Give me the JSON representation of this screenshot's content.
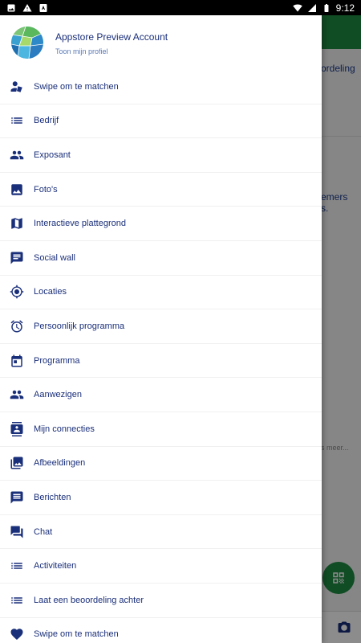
{
  "status_bar": {
    "time": "9:12"
  },
  "background": {
    "text_1": "ordeling",
    "text_2": "emers",
    "text_3": "s.",
    "text_4": "s meer..."
  },
  "profile": {
    "name": "Appstore Preview Account",
    "subtitle": "Toon mijn profiel"
  },
  "menu": [
    {
      "label": "Swipe om te matchen",
      "icon": "person-swipe-icon"
    },
    {
      "label": "Bedrijf",
      "icon": "list-icon"
    },
    {
      "label": "Exposant",
      "icon": "people-icon"
    },
    {
      "label": "Foto's",
      "icon": "image-icon"
    },
    {
      "label": "Interactieve plattegrond",
      "icon": "map-icon"
    },
    {
      "label": "Social wall",
      "icon": "chat-bubble-icon"
    },
    {
      "label": "Locaties",
      "icon": "crosshair-icon"
    },
    {
      "label": "Persoonlijk programma",
      "icon": "alarm-clock-icon"
    },
    {
      "label": "Programma",
      "icon": "calendar-icon"
    },
    {
      "label": "Aanwezigen",
      "icon": "people-icon"
    },
    {
      "label": "Mijn connecties",
      "icon": "contact-card-icon"
    },
    {
      "label": "Afbeeldingen",
      "icon": "photo-library-icon"
    },
    {
      "label": "Berichten",
      "icon": "message-icon"
    },
    {
      "label": "Chat",
      "icon": "forum-icon"
    },
    {
      "label": "Activiteiten",
      "icon": "list-icon"
    },
    {
      "label": "Laat een beoordeling achter",
      "icon": "list-icon"
    },
    {
      "label": "Swipe om te matchen",
      "icon": "heart-icon"
    }
  ],
  "colors": {
    "accent": "#1a2f7a",
    "brand_green": "#1e8a43"
  }
}
